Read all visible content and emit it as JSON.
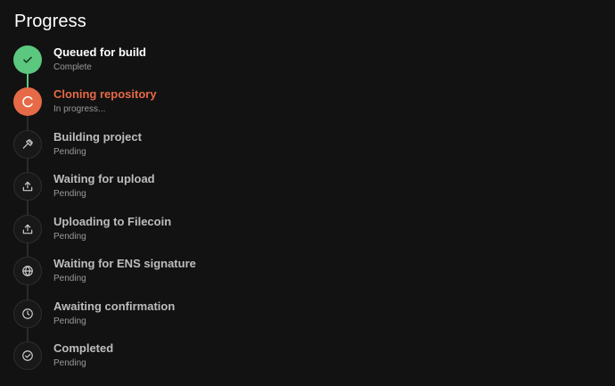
{
  "page": {
    "title": "Progress"
  },
  "colors": {
    "background": "#121212",
    "complete": "#5cc77f",
    "active": "#e66a47",
    "pending_text": "#bdbdbd",
    "status_text": "#9a9a9a"
  },
  "steps": [
    {
      "label": "Queued for build",
      "status": "Complete",
      "state": "complete",
      "icon": "check-icon"
    },
    {
      "label": "Cloning repository",
      "status": "In progress...",
      "state": "active",
      "icon": "spinner-icon"
    },
    {
      "label": "Building project",
      "status": "Pending",
      "state": "pending",
      "icon": "hammer-icon"
    },
    {
      "label": "Waiting for upload",
      "status": "Pending",
      "state": "pending",
      "icon": "upload-icon"
    },
    {
      "label": "Uploading to Filecoin",
      "status": "Pending",
      "state": "pending",
      "icon": "upload-icon"
    },
    {
      "label": "Waiting for ENS signature",
      "status": "Pending",
      "state": "pending",
      "icon": "globe-icon"
    },
    {
      "label": "Awaiting confirmation",
      "status": "Pending",
      "state": "pending",
      "icon": "clock-icon"
    },
    {
      "label": "Completed",
      "status": "Pending",
      "state": "pending",
      "icon": "check-circle-icon"
    }
  ]
}
